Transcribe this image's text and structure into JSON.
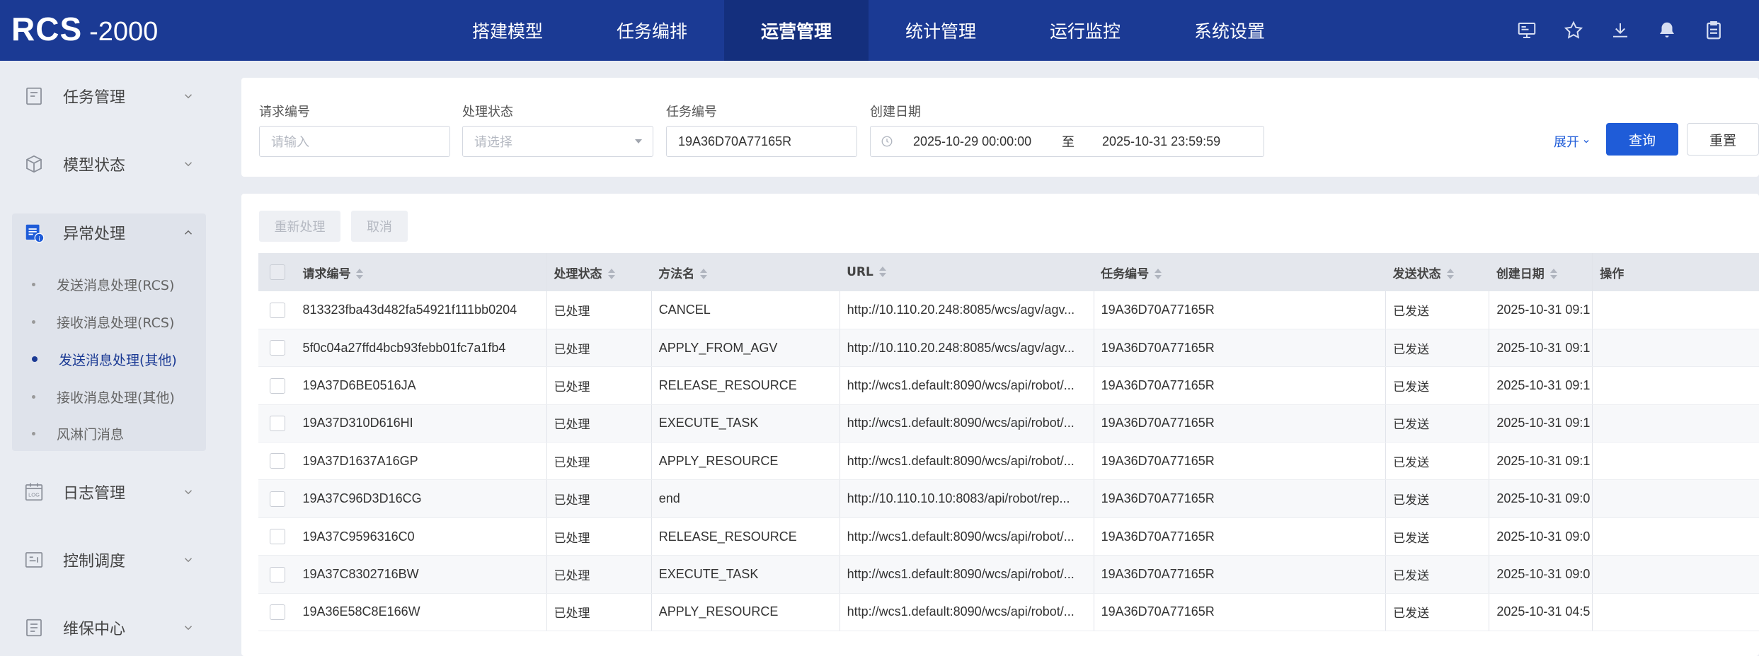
{
  "app": {
    "logo_main": "RCS",
    "logo_sub": "-2000"
  },
  "nav": {
    "tabs": [
      {
        "label": "搭建模型"
      },
      {
        "label": "任务编排"
      },
      {
        "label": "运营管理"
      },
      {
        "label": "统计管理"
      },
      {
        "label": "运行监控"
      },
      {
        "label": "系统设置"
      }
    ],
    "active": "运营管理",
    "icons": [
      "monitor-icon",
      "star-icon",
      "download-icon",
      "bell-icon",
      "clipboard-icon"
    ]
  },
  "sidebar": {
    "groups": [
      {
        "label": "任务管理",
        "icon": "task-icon"
      },
      {
        "label": "模型状态",
        "icon": "cube-icon"
      },
      {
        "label": "异常处理",
        "icon": "exception-icon"
      },
      {
        "label": "日志管理",
        "icon": "log-icon"
      },
      {
        "label": "控制调度",
        "icon": "control-icon"
      },
      {
        "label": "维保中心",
        "icon": "maintenance-icon"
      }
    ],
    "subitems": [
      {
        "label": "发送消息处理(RCS)"
      },
      {
        "label": "接收消息处理(RCS)"
      },
      {
        "label": "发送消息处理(其他)"
      },
      {
        "label": "接收消息处理(其他)"
      },
      {
        "label": "风淋门消息"
      }
    ],
    "active_subitem": "发送消息处理(其他)"
  },
  "filter": {
    "request_no": {
      "label": "请求编号",
      "placeholder": "请输入"
    },
    "status": {
      "label": "处理状态",
      "placeholder": "请选择"
    },
    "task_no": {
      "label": "任务编号",
      "value": "19A36D70A77165R"
    },
    "created": {
      "label": "创建日期",
      "start": "2025-10-29 00:00:00",
      "sep": "至",
      "end": "2025-10-31 23:59:59"
    },
    "expand_label": "展开",
    "query_label": "查询",
    "reset_label": "重置"
  },
  "actions": {
    "reprocess_label": "重新处理",
    "cancel_label": "取消"
  },
  "table": {
    "headers": {
      "request_no": "请求编号",
      "status": "处理状态",
      "method": "方法名",
      "url": "URL",
      "task_no": "任务编号",
      "send_status": "发送状态",
      "created": "创建日期",
      "ops": "操作"
    },
    "rows": [
      {
        "request_no": "813323fba43d482fa54921f111bb0204",
        "status": "已处理",
        "method": "CANCEL",
        "url": "http://10.110.20.248:8085/wcs/agv/agv...",
        "task_no": "19A36D70A77165R",
        "send_status": "已发送",
        "created": "2025-10-31 09:1"
      },
      {
        "request_no": "5f0c04a27ffd4bcb93febb01fc7a1fb4",
        "status": "已处理",
        "method": "APPLY_FROM_AGV",
        "url": "http://10.110.20.248:8085/wcs/agv/agv...",
        "task_no": "19A36D70A77165R",
        "send_status": "已发送",
        "created": "2025-10-31 09:1"
      },
      {
        "request_no": "19A37D6BE0516JA",
        "status": "已处理",
        "method": "RELEASE_RESOURCE",
        "url": "http://wcs1.default:8090/wcs/api/robot/...",
        "task_no": "19A36D70A77165R",
        "send_status": "已发送",
        "created": "2025-10-31 09:1"
      },
      {
        "request_no": "19A37D310D616HI",
        "status": "已处理",
        "method": "EXECUTE_TASK",
        "url": "http://wcs1.default:8090/wcs/api/robot/...",
        "task_no": "19A36D70A77165R",
        "send_status": "已发送",
        "created": "2025-10-31 09:1"
      },
      {
        "request_no": "19A37D1637A16GP",
        "status": "已处理",
        "method": "APPLY_RESOURCE",
        "url": "http://wcs1.default:8090/wcs/api/robot/...",
        "task_no": "19A36D70A77165R",
        "send_status": "已发送",
        "created": "2025-10-31 09:1"
      },
      {
        "request_no": "19A37C96D3D16CG",
        "status": "已处理",
        "method": "end",
        "url": "http://10.110.10.10:8083/api/robot/rep...",
        "task_no": "19A36D70A77165R",
        "send_status": "已发送",
        "created": "2025-10-31 09:0"
      },
      {
        "request_no": "19A37C9596316C0",
        "status": "已处理",
        "method": "RELEASE_RESOURCE",
        "url": "http://wcs1.default:8090/wcs/api/robot/...",
        "task_no": "19A36D70A77165R",
        "send_status": "已发送",
        "created": "2025-10-31 09:0"
      },
      {
        "request_no": "19A37C8302716BW",
        "status": "已处理",
        "method": "EXECUTE_TASK",
        "url": "http://wcs1.default:8090/wcs/api/robot/...",
        "task_no": "19A36D70A77165R",
        "send_status": "已发送",
        "created": "2025-10-31 09:0"
      },
      {
        "request_no": "19A36E58C8E166W",
        "status": "已处理",
        "method": "APPLY_RESOURCE",
        "url": "http://wcs1.default:8090/wcs/api/robot/...",
        "task_no": "19A36D70A77165R",
        "send_status": "已发送",
        "created": "2025-10-31 04:5"
      }
    ]
  },
  "colors": {
    "nav_bg": "#1b3a94",
    "nav_active": "#142f7d",
    "primary": "#1f5cd8",
    "page_bg": "#e9ecf2"
  }
}
